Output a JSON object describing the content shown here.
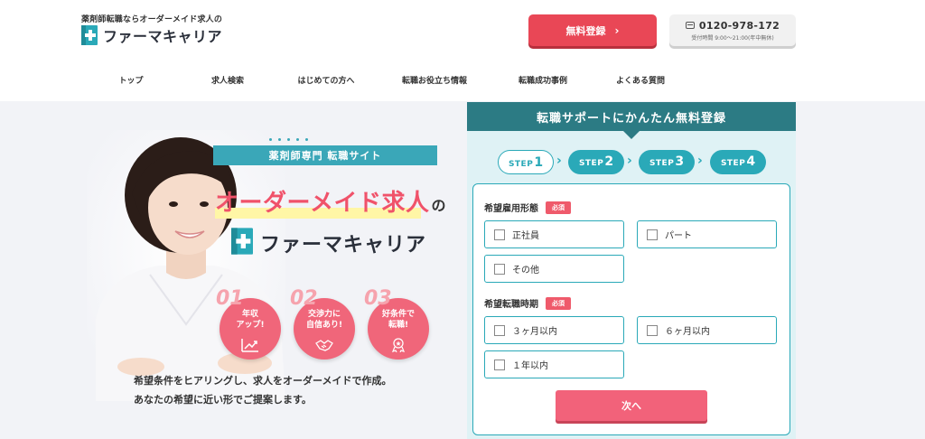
{
  "header": {
    "tagline": "薬剤師転職ならオーダーメイド求人の",
    "logo_text": "ファーマキャリア",
    "register_button": "無料登録",
    "tel_number": "0120-978-172",
    "tel_hours": "受付時間 9:00～21:00(年中無休)"
  },
  "nav": {
    "items": [
      "トップ",
      "求人検索",
      "はじめての方へ",
      "転職お役立ち情報",
      "転職成功事例",
      "よくある質問"
    ]
  },
  "hero": {
    "badge": "薬剤師専門 転職サイト",
    "headline": "オーダーメイド求人",
    "headline_suffix": "の",
    "brand": "ファーマキャリア",
    "points": [
      {
        "num": "01",
        "text": "年収\nアップ!",
        "icon": "chart-up-icon"
      },
      {
        "num": "02",
        "text": "交渉力に\n自信あり!",
        "icon": "handshake-icon"
      },
      {
        "num": "03",
        "text": "好条件で\n転職!",
        "icon": "medal-icon"
      }
    ],
    "description": "希望条件をヒアリングし、求人をオーダーメイドで作成。\nあなたの希望に近い形でご提案します。"
  },
  "form": {
    "title": "転職サポートにかんたん無料登録",
    "steps": [
      {
        "label": "STEP",
        "num": "1",
        "state": "active"
      },
      {
        "label": "STEP",
        "num": "2",
        "state": "todo"
      },
      {
        "label": "STEP",
        "num": "3",
        "state": "todo"
      },
      {
        "label": "STEP",
        "num": "4",
        "state": "todo"
      }
    ],
    "q1": {
      "label": "希望雇用形態",
      "required": "必須",
      "options": [
        "正社員",
        "パート",
        "その他"
      ]
    },
    "q2": {
      "label": "希望転職時期",
      "required": "必須",
      "options": [
        "３ヶ月以内",
        "６ヶ月以内",
        "１年以内"
      ]
    },
    "next_button": "次へ"
  },
  "colors": {
    "accent_red": "#e94756",
    "accent_pink": "#f0526a",
    "teal": "#2aa9b8",
    "teal_dark": "#2c7b84"
  }
}
